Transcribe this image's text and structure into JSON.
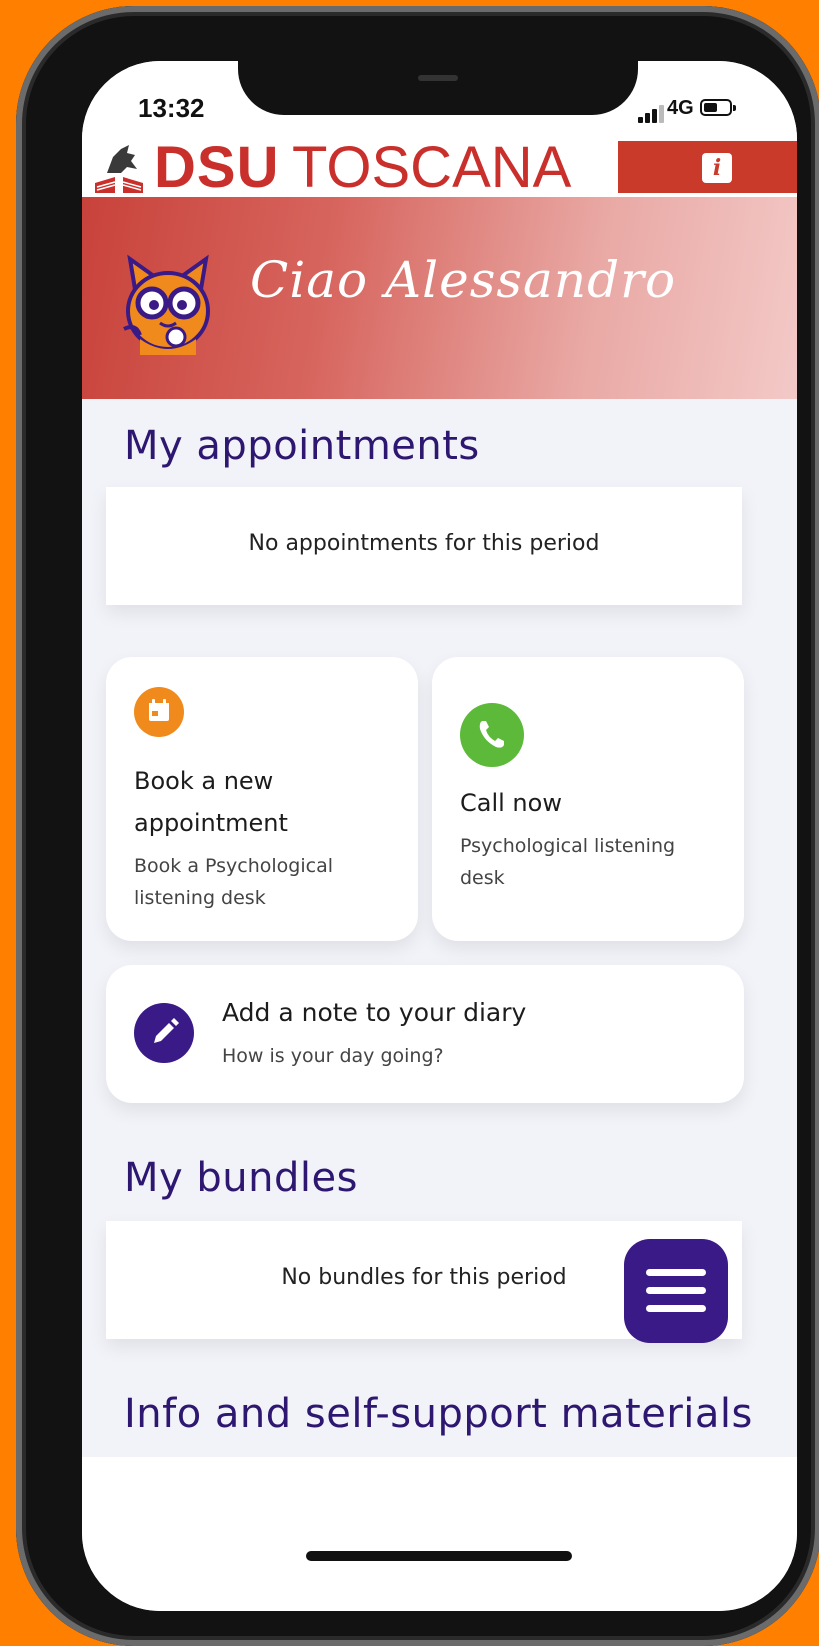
{
  "status_bar": {
    "time": "13:32",
    "network": "4G"
  },
  "brand": {
    "dsu": "DSU",
    "toscana": "TOSCANA",
    "info_label": "i",
    "color": "#c9302c"
  },
  "hero": {
    "greeting": "Ciao Alessandro"
  },
  "appointments": {
    "title": "My appointments",
    "empty_text": "No appointments for this period"
  },
  "actions": {
    "book": {
      "title_line1": "Book a new",
      "title_line2": "appointment",
      "subtitle_line1": "Book a Psychological",
      "subtitle_line2": "listening desk",
      "icon": "calendar-icon",
      "color": "#f08a1c"
    },
    "call": {
      "title": "Call now",
      "subtitle_line1": "Psychological listening",
      "subtitle_line2": "desk",
      "icon": "phone-icon",
      "color": "#5cb93a"
    },
    "diary": {
      "title": "Add a note to your diary",
      "subtitle": "How is your day going?",
      "icon": "pencil-icon",
      "color": "#3a1a86"
    }
  },
  "bundles": {
    "title": "My bundles",
    "empty_text": "No bundles for this period"
  },
  "info_section": {
    "title": "Info and self-support materials"
  },
  "menu": {
    "icon": "menu-icon",
    "color": "#3a1a86"
  }
}
